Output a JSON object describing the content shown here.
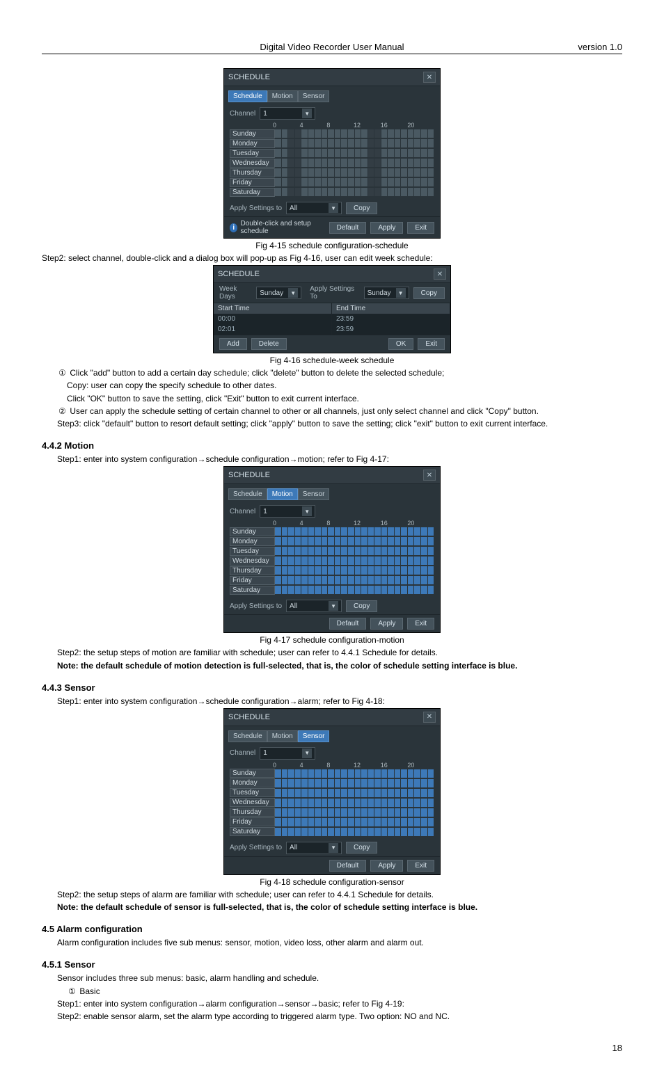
{
  "header": {
    "title": "Digital Video Recorder User Manual",
    "version": "version 1.0"
  },
  "page_number": "18",
  "fig15": {
    "caption": "Fig 4-15 schedule configuration-schedule",
    "panel_title": "SCHEDULE",
    "tabs": [
      "Schedule",
      "Motion",
      "Sensor"
    ],
    "active_tab": 0,
    "channel_label": "Channel",
    "channel_value": "1",
    "ticks": [
      "0",
      "4",
      "8",
      "12",
      "16",
      "20"
    ],
    "days": [
      "Sunday",
      "Monday",
      "Tuesday",
      "Wednesday",
      "Thursday",
      "Friday",
      "Saturday"
    ],
    "apply_label": "Apply Settings to",
    "apply_value": "All",
    "copy_label": "Copy",
    "info": "Double-click and setup schedule",
    "buttons": [
      "Default",
      "Apply",
      "Exit"
    ]
  },
  "step2_text": "Step2: select channel, double-click and a dialog box will pop-up as Fig 4-16, user can edit week schedule:",
  "fig16": {
    "caption": "Fig 4-16 schedule-week schedule",
    "panel_title": "SCHEDULE",
    "weekdays_label": "Week Days",
    "weekdays_value": "Sunday",
    "apply_label": "Apply Settings To",
    "apply_value": "Sunday",
    "copy_label": "Copy",
    "start_label": "Start Time",
    "end_label": "End Time",
    "row1_start": "00:00",
    "row1_end": "23:59",
    "row2_start": "02:01",
    "row2_end": "23:59",
    "add_label": "Add",
    "delete_label": "Delete",
    "ok_label": "OK",
    "exit_label": "Exit"
  },
  "bullets415": {
    "b1_num": "①",
    "b1_text": "Click \"add\" button to add a certain day schedule; click \"delete\" button to delete the selected schedule;",
    "copy_text": "Copy: user can copy the specify schedule to other dates.",
    "ok_text": "Click \"OK\" button to save the setting, click \"Exit\" button to exit current interface.",
    "b2_num": "②",
    "b2_text": "User can apply the schedule setting of certain channel to other or all channels, just only select channel and click \"Copy\" button.",
    "step3": "Step3: click \"default\" button to resort default setting; click \"apply\" button to save the setting; click \"exit\" button to exit current interface."
  },
  "section442": {
    "heading": "4.4.2  Motion",
    "step1": "Step1: enter into system configuration→schedule configuration→motion; refer to Fig 4-17:"
  },
  "fig17": {
    "caption": "Fig 4-17 schedule configuration-motion",
    "panel_title": "SCHEDULE",
    "tabs": [
      "Schedule",
      "Motion",
      "Sensor"
    ],
    "active_tab": 1,
    "channel_label": "Channel",
    "channel_value": "1",
    "ticks": [
      "0",
      "4",
      "8",
      "12",
      "16",
      "20"
    ],
    "days": [
      "Sunday",
      "Monday",
      "Tuesday",
      "Wednesday",
      "Thursday",
      "Friday",
      "Saturday"
    ],
    "apply_label": "Apply Settings to",
    "apply_value": "All",
    "copy_label": "Copy",
    "buttons": [
      "Default",
      "Apply",
      "Exit"
    ]
  },
  "motion_step2": "Step2: the setup steps of motion are familiar with schedule; user can refer to 4.4.1 Schedule for details.",
  "motion_note": "Note: the default schedule of motion detection is full-selected, that is, the color of schedule setting interface is blue.",
  "section443": {
    "heading": "4.4.3  Sensor",
    "step1": "Step1: enter into system configuration→schedule configuration→alarm; refer to Fig 4-18:"
  },
  "fig18": {
    "caption": "Fig 4-18 schedule configuration-sensor",
    "panel_title": "SCHEDULE",
    "tabs": [
      "Schedule",
      "Motion",
      "Sensor"
    ],
    "active_tab": 2,
    "channel_label": "Channel",
    "channel_value": "1",
    "ticks": [
      "0",
      "4",
      "8",
      "12",
      "16",
      "20"
    ],
    "days": [
      "Sunday",
      "Monday",
      "Tuesday",
      "Wednesday",
      "Thursday",
      "Friday",
      "Saturday"
    ],
    "apply_label": "Apply Settings to",
    "apply_value": "All",
    "copy_label": "Copy",
    "buttons": [
      "Default",
      "Apply",
      "Exit"
    ]
  },
  "sensor_step2": "Step2: the setup steps of alarm are familiar with schedule; user can refer to 4.4.1 Schedule for details.",
  "sensor_note": "Note: the default schedule of sensor is full-selected, that is, the color of schedule setting interface is blue.",
  "section45": {
    "heading": "4.5  Alarm configuration",
    "text": "Alarm configuration includes five sub menus: sensor, motion, video loss, other alarm and alarm out."
  },
  "section451": {
    "heading": "4.5.1  Sensor",
    "line1": "Sensor includes three sub menus: basic, alarm handling and schedule.",
    "num": "①",
    "basic": "Basic",
    "step1": "Step1: enter into system configuration→alarm configuration→sensor→basic; refer to Fig 4-19:",
    "step2": "Step2: enable sensor alarm, set the alarm type according to triggered alarm type. Two option: NO and NC."
  }
}
